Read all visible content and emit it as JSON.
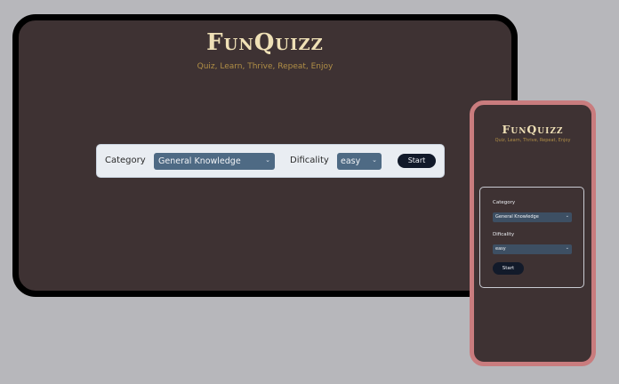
{
  "app": {
    "title": "FunQuizz",
    "tagline": "Quiz, Learn, Thrive, Repeat, Enjoy"
  },
  "form": {
    "category_label": "Category",
    "category_value": "General Knowledge",
    "difficulty_label": "Dificality",
    "difficulty_value": "easy",
    "start_label": "Start",
    "chevron": "⌄"
  },
  "colors": {
    "page_background": "#b7b7bb",
    "app_background": "#3e3233",
    "logo": "#efe0b6",
    "tagline": "#b08e46",
    "form_bar": "#e9edf2",
    "select": "#4e6a84",
    "button": "#121a2a",
    "phone_frame": "#c97c7e",
    "desktop_frame": "#000000"
  }
}
